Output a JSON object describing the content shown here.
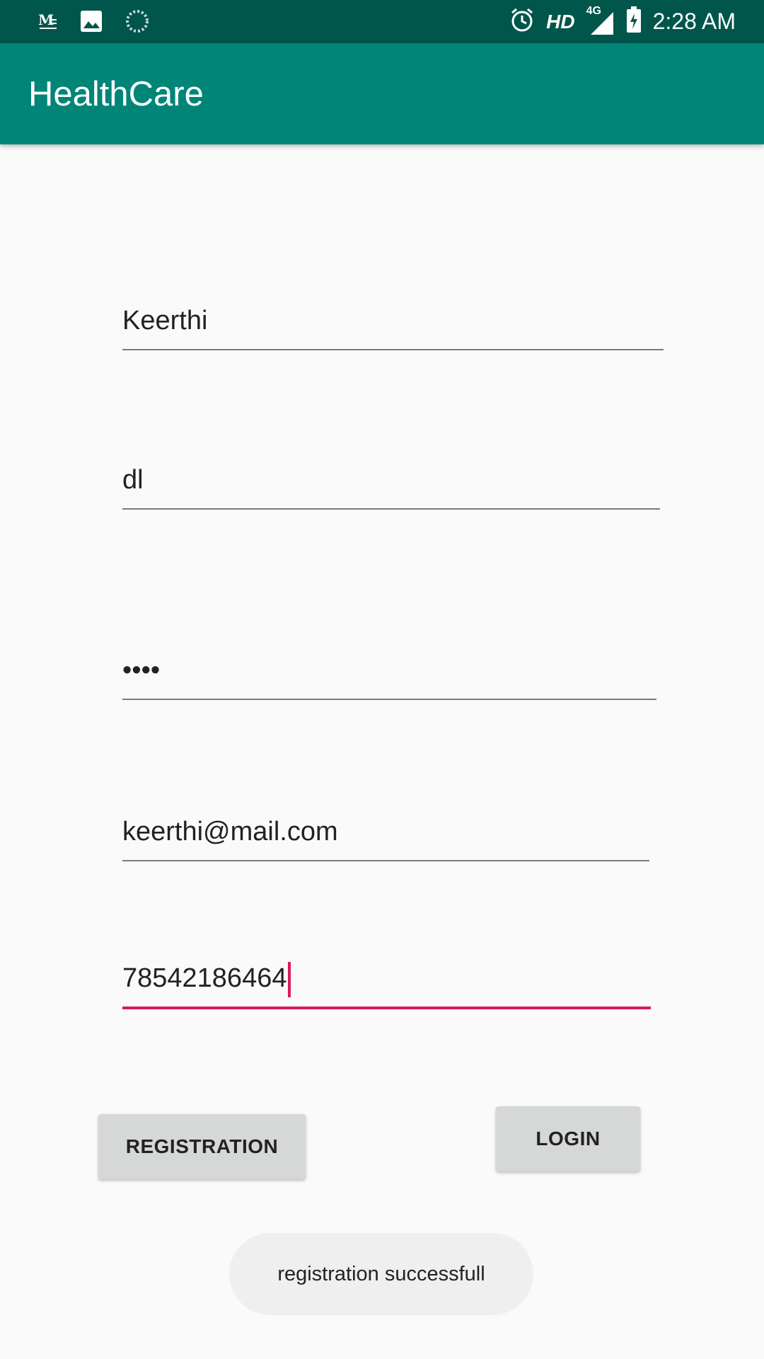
{
  "status_bar": {
    "time": "2:28 AM",
    "network_label": "HD",
    "network_type": "4G",
    "icons": [
      "gmail-icon",
      "image-icon",
      "sync-icon",
      "alarm-icon",
      "signal-icon",
      "battery-charging-icon"
    ]
  },
  "app_bar": {
    "title": "HealthCare"
  },
  "form": {
    "username": "Keerthi",
    "address": "dl",
    "password_masked": "••••",
    "email": "keerthi@mail.com",
    "phone": "78542186464"
  },
  "buttons": {
    "registration_label": "REGISTRATION",
    "login_label": "LOGIN"
  },
  "toast": {
    "message": "registration successfull"
  },
  "colors": {
    "status_bar": "#00564b",
    "app_bar": "#008577",
    "accent": "#d81b60",
    "button": "#d6d7d7"
  }
}
